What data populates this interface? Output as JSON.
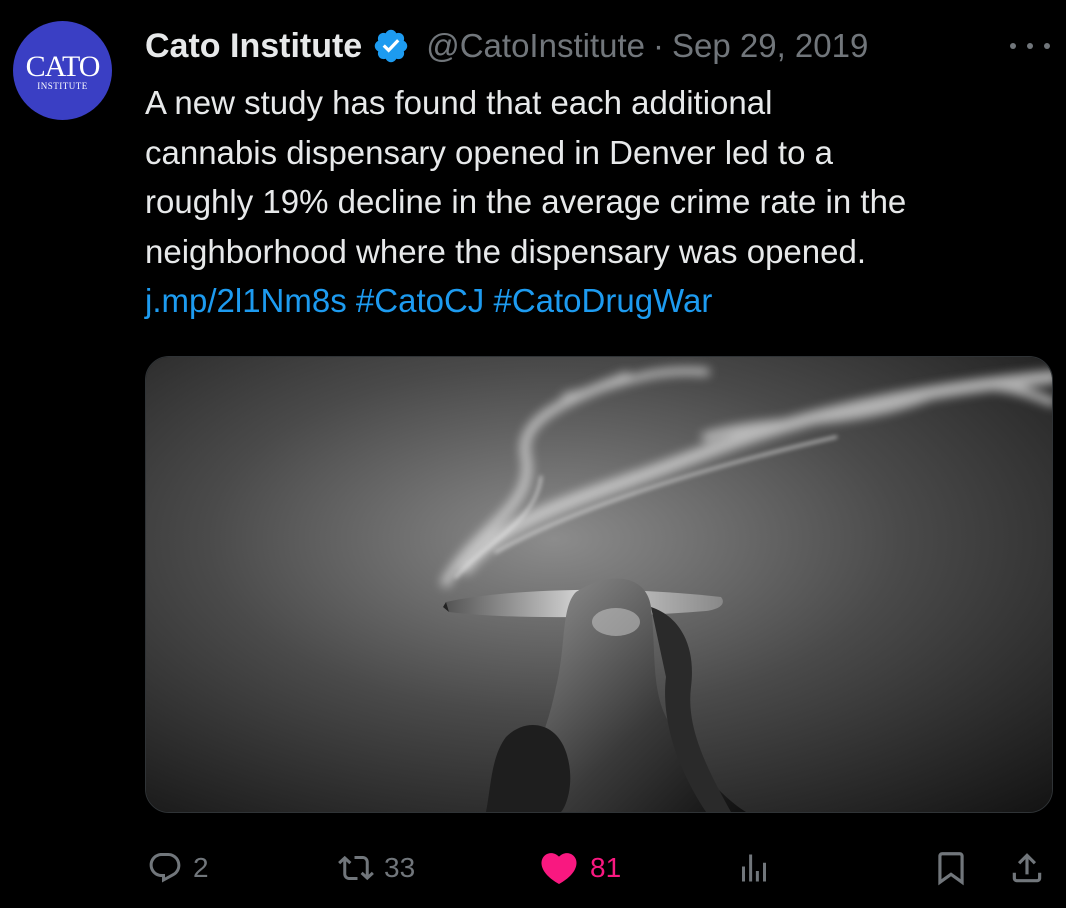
{
  "author": {
    "name": "Cato Institute",
    "handle": "@CatoInstitute",
    "separator": "·",
    "date": "Sep 29, 2019",
    "verified": true,
    "avatar": {
      "logo_text": "CATO",
      "logo_subtext": "INSTITUTE",
      "background": "#3a3fc4"
    }
  },
  "tweet": {
    "lines": [
      "A new study has found that each additional",
      "cannabis dispensary opened in Denver led to a",
      "roughly 19% decline in the average crime rate in the",
      "neighborhood where the dispensary was opened."
    ],
    "link": "j.mp/2l1Nm8s",
    "hashtags": [
      "#CatoCJ",
      "#CatoDrugWar"
    ]
  },
  "media": {
    "icon": "image-joint-smoke"
  },
  "actions": {
    "reply": {
      "icon": "reply-icon",
      "count": "2"
    },
    "retweet": {
      "icon": "retweet-icon",
      "count": "33"
    },
    "like": {
      "icon": "heart-icon",
      "count": "81",
      "active": true
    },
    "views": {
      "icon": "views-icon"
    },
    "bookmark": {
      "icon": "bookmark-icon"
    },
    "share": {
      "icon": "share-icon"
    }
  },
  "colors": {
    "background": "#000000",
    "text": "#e7e9ea",
    "secondary": "#71767b",
    "link": "#1d9bf0",
    "like": "#f91880",
    "verified": "#1d9bf0"
  }
}
